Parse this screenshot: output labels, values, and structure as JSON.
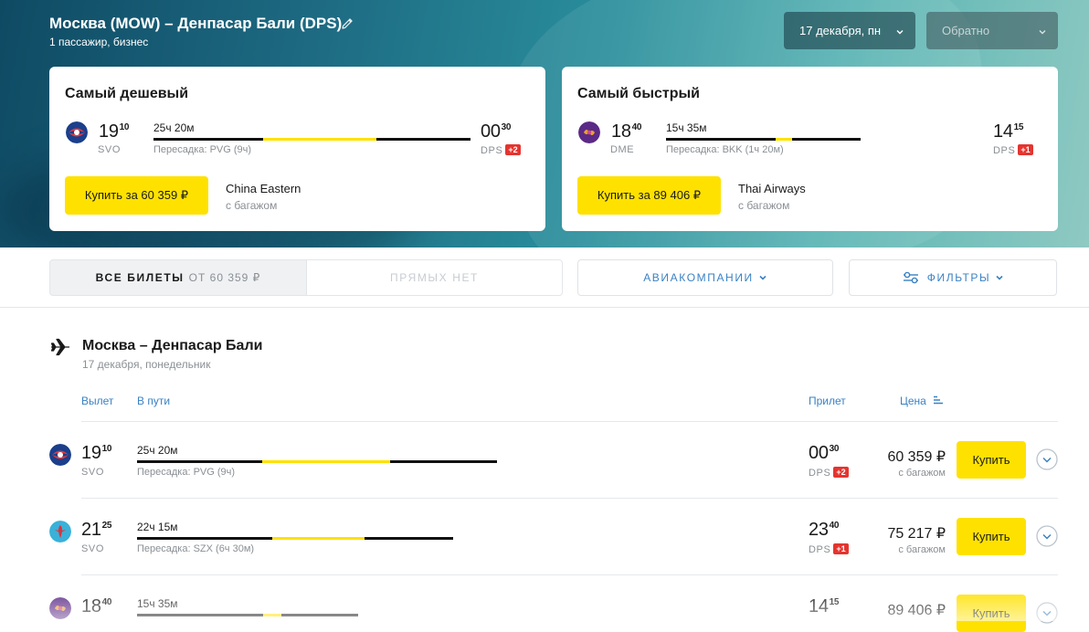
{
  "header": {
    "route_title": "Москва (MOW) – Денпасар Бали (DPS)",
    "route_sub": "1 пассажир, бизнес",
    "depart_date": "17 декабря, пн",
    "return_date": "Обратно"
  },
  "promos": [
    {
      "title": "Самый дешевый",
      "airline_logo": "china-eastern-logo",
      "dep_h": "19",
      "dep_m": "10",
      "dep_code": "SVO",
      "duration": "25ч 20м",
      "stop": "Пересадка: PVG (9ч)",
      "arr_h": "00",
      "arr_m": "30",
      "arr_code": "DPS",
      "arr_badge": "+2",
      "buy_label": "Купить за 60 359 ₽",
      "airline": "China Eastern",
      "baggage": "с багажом"
    },
    {
      "title": "Самый быстрый",
      "airline_logo": "thai-airways-logo",
      "dep_h": "18",
      "dep_m": "40",
      "dep_code": "DME",
      "duration": "15ч 35м",
      "stop": "Пересадка: BKK (1ч 20м)",
      "arr_h": "14",
      "arr_m": "15",
      "arr_code": "DPS",
      "arr_badge": "+1",
      "buy_label": "Купить за 89 406 ₽",
      "airline": "Thai Airways",
      "baggage": "с багажом"
    }
  ],
  "filters": {
    "all_label": "ВСЕ БИЛЕТЫ",
    "all_from": "ОТ 60 359 ₽",
    "direct_label": "ПРЯМЫХ НЕТ",
    "airlines_label": "АВИАКОМПАНИИ",
    "filters_label": "ФИЛЬТРЫ"
  },
  "results": {
    "title": "Москва – Денпасар Бали",
    "date": "17 декабря, понедельник",
    "columns": {
      "departure": "Вылет",
      "enroute": "В пути",
      "arrival": "Прилет",
      "price": "Цена"
    },
    "rows": [
      {
        "airline_logo": "china-eastern-logo",
        "dep_h": "19",
        "dep_m": "10",
        "dep_code": "SVO",
        "duration": "25ч 20м",
        "stop": "Пересадка: PVG (9ч)",
        "arr_h": "00",
        "arr_m": "30",
        "arr_code": "DPS",
        "arr_badge": "+2",
        "price": "60 359 ₽",
        "baggage": "с багажом",
        "buy_label": "Купить"
      },
      {
        "airline_logo": "china-southern-logo",
        "dep_h": "21",
        "dep_m": "25",
        "dep_code": "SVO",
        "duration": "22ч 15м",
        "stop": "Пересадка: SZX (6ч 30м)",
        "arr_h": "23",
        "arr_m": "40",
        "arr_code": "DPS",
        "arr_badge": "+1",
        "price": "75 217 ₽",
        "baggage": "с багажом",
        "buy_label": "Купить"
      },
      {
        "airline_logo": "thai-airways-logo",
        "dep_h": "18",
        "dep_m": "40",
        "dep_code": "",
        "duration": "15ч 35м",
        "stop": "",
        "arr_h": "14",
        "arr_m": "15",
        "arr_code": "",
        "arr_badge": "",
        "price": "89 406 ₽",
        "baggage": "",
        "buy_label": "Купить"
      }
    ]
  },
  "colors": {
    "accent_yellow": "#ffe100",
    "link_blue": "#3a82c4",
    "badge_red": "#e5342f"
  }
}
